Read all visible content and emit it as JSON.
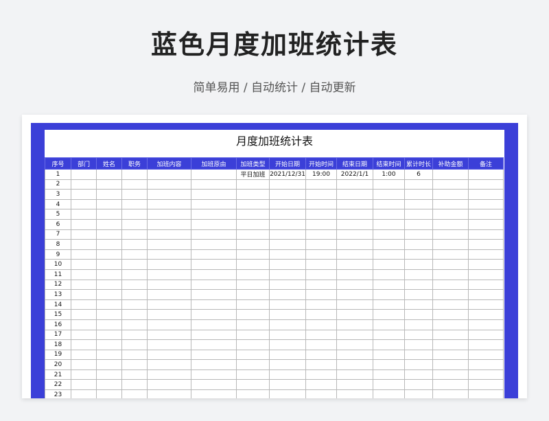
{
  "page": {
    "title": "蓝色月度加班统计表",
    "subtitle": "简单易用 / 自动统计 / 自动更新"
  },
  "sheet": {
    "title": "月度加班统计表",
    "columns": [
      "序号",
      "部门",
      "姓名",
      "职务",
      "加班内容",
      "加班原由",
      "加班类型",
      "开始日期",
      "开始时间",
      "结束日期",
      "结束时间",
      "累计时长",
      "补助金额",
      "备注"
    ],
    "rows": [
      [
        "1",
        "",
        "",
        "",
        "",
        "",
        "平日加班",
        "2021/12/31",
        "19:00",
        "2022/1/1",
        "1:00",
        "6",
        "",
        ""
      ],
      [
        "2",
        "",
        "",
        "",
        "",
        "",
        "",
        "",
        "",
        "",
        "",
        "",
        "",
        ""
      ],
      [
        "3",
        "",
        "",
        "",
        "",
        "",
        "",
        "",
        "",
        "",
        "",
        "",
        "",
        ""
      ],
      [
        "4",
        "",
        "",
        "",
        "",
        "",
        "",
        "",
        "",
        "",
        "",
        "",
        "",
        ""
      ],
      [
        "5",
        "",
        "",
        "",
        "",
        "",
        "",
        "",
        "",
        "",
        "",
        "",
        "",
        ""
      ],
      [
        "6",
        "",
        "",
        "",
        "",
        "",
        "",
        "",
        "",
        "",
        "",
        "",
        "",
        ""
      ],
      [
        "7",
        "",
        "",
        "",
        "",
        "",
        "",
        "",
        "",
        "",
        "",
        "",
        "",
        ""
      ],
      [
        "8",
        "",
        "",
        "",
        "",
        "",
        "",
        "",
        "",
        "",
        "",
        "",
        "",
        ""
      ],
      [
        "9",
        "",
        "",
        "",
        "",
        "",
        "",
        "",
        "",
        "",
        "",
        "",
        "",
        ""
      ],
      [
        "10",
        "",
        "",
        "",
        "",
        "",
        "",
        "",
        "",
        "",
        "",
        "",
        "",
        ""
      ],
      [
        "11",
        "",
        "",
        "",
        "",
        "",
        "",
        "",
        "",
        "",
        "",
        "",
        "",
        ""
      ],
      [
        "12",
        "",
        "",
        "",
        "",
        "",
        "",
        "",
        "",
        "",
        "",
        "",
        "",
        ""
      ],
      [
        "13",
        "",
        "",
        "",
        "",
        "",
        "",
        "",
        "",
        "",
        "",
        "",
        "",
        ""
      ],
      [
        "14",
        "",
        "",
        "",
        "",
        "",
        "",
        "",
        "",
        "",
        "",
        "",
        "",
        ""
      ],
      [
        "15",
        "",
        "",
        "",
        "",
        "",
        "",
        "",
        "",
        "",
        "",
        "",
        "",
        ""
      ],
      [
        "16",
        "",
        "",
        "",
        "",
        "",
        "",
        "",
        "",
        "",
        "",
        "",
        "",
        ""
      ],
      [
        "17",
        "",
        "",
        "",
        "",
        "",
        "",
        "",
        "",
        "",
        "",
        "",
        "",
        ""
      ],
      [
        "18",
        "",
        "",
        "",
        "",
        "",
        "",
        "",
        "",
        "",
        "",
        "",
        "",
        ""
      ],
      [
        "19",
        "",
        "",
        "",
        "",
        "",
        "",
        "",
        "",
        "",
        "",
        "",
        "",
        ""
      ],
      [
        "20",
        "",
        "",
        "",
        "",
        "",
        "",
        "",
        "",
        "",
        "",
        "",
        "",
        ""
      ],
      [
        "21",
        "",
        "",
        "",
        "",
        "",
        "",
        "",
        "",
        "",
        "",
        "",
        "",
        ""
      ],
      [
        "22",
        "",
        "",
        "",
        "",
        "",
        "",
        "",
        "",
        "",
        "",
        "",
        "",
        ""
      ],
      [
        "23",
        "",
        "",
        "",
        "",
        "",
        "",
        "",
        "",
        "",
        "",
        "",
        "",
        ""
      ]
    ]
  },
  "colors": {
    "accent": "#3b3fd8",
    "background": "#f2f3f5"
  }
}
